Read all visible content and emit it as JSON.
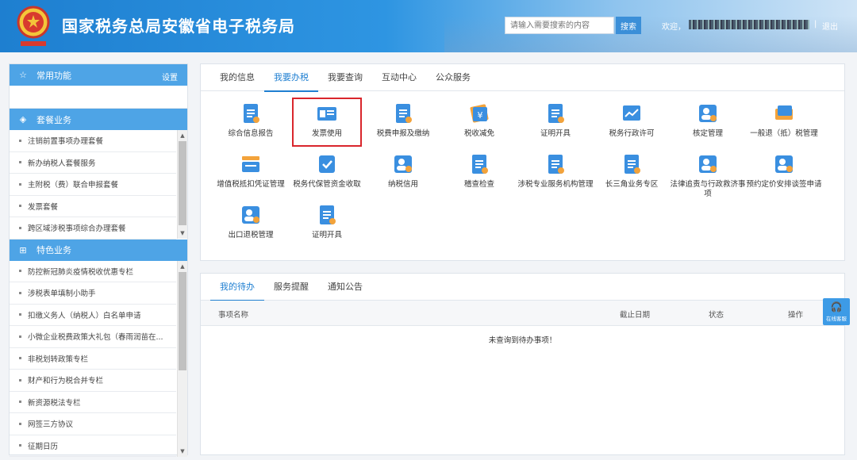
{
  "header": {
    "title": "国家税务总局安徽省电子税务局",
    "search_placeholder": "请输入需要搜索的内容",
    "search_button": "搜索",
    "welcome": "欢迎，",
    "separator": "|",
    "logout": "退出"
  },
  "sidebar": {
    "common": {
      "title": "常用功能",
      "settings": "设置"
    },
    "package": {
      "title": "套餐业务",
      "items": [
        "注销前置事项办理套餐",
        "新办纳税人套餐服务",
        "主附税（费）联合申报套餐",
        "发票套餐",
        "跨区域涉税事项综合办理套餐"
      ]
    },
    "special": {
      "title": "特色业务",
      "items": [
        "防控新冠肺炎疫情税收优惠专栏",
        "涉税表单填制小助手",
        "扣缴义务人（纳税人）白名单申请",
        "小微企业税费政策大礼包（春雨润苗在...",
        "非税划转政策专栏",
        "财产和行为税合并专栏",
        "新资源税法专栏",
        "网签三方协议",
        "征期日历"
      ]
    }
  },
  "main_tabs": [
    {
      "label": "我的信息"
    },
    {
      "label": "我要办税",
      "active": true
    },
    {
      "label": "我要查询"
    },
    {
      "label": "互动中心"
    },
    {
      "label": "公众服务"
    }
  ],
  "apps": [
    {
      "label": "综合信息报告",
      "icon": "report-icon"
    },
    {
      "label": "发票使用",
      "icon": "invoice-icon"
    },
    {
      "label": "税费申报及缴纳",
      "icon": "tax-declare-icon"
    },
    {
      "label": "税收减免",
      "icon": "tax-reduction-icon"
    },
    {
      "label": "证明开具",
      "icon": "certificate-icon"
    },
    {
      "label": "税务行政许可",
      "icon": "admin-license-icon"
    },
    {
      "label": "核定管理",
      "icon": "verification-icon"
    },
    {
      "label": "一般退（抵）税管理",
      "icon": "tax-refund-icon"
    },
    {
      "label": "增值税抵扣凭证管理",
      "icon": "vat-voucher-icon"
    },
    {
      "label": "税务代保管资金收取",
      "icon": "fund-custody-icon"
    },
    {
      "label": "纳税信用",
      "icon": "tax-credit-icon"
    },
    {
      "label": "稽查检查",
      "icon": "audit-icon"
    },
    {
      "label": "涉税专业服务机构管理",
      "icon": "agency-icon"
    },
    {
      "label": "长三角业务专区",
      "icon": "yangtze-icon"
    },
    {
      "label": "法律追责与行政救济事项",
      "icon": "legal-icon"
    },
    {
      "label": "预约定价安排谈签申请",
      "icon": "pricing-icon"
    },
    {
      "label": "出口退税管理",
      "icon": "export-refund-icon"
    },
    {
      "label": "证明开具",
      "icon": "certificate-icon"
    }
  ],
  "todo": {
    "tabs": [
      {
        "label": "我的待办",
        "active": true
      },
      {
        "label": "服务提醒"
      },
      {
        "label": "通知公告"
      }
    ],
    "columns": {
      "name": "事项名称",
      "deadline": "截止日期",
      "status": "状态",
      "action": "操作"
    },
    "empty": "未查询到待办事项！"
  },
  "float_service": {
    "label": "在线客服"
  },
  "colors": {
    "primary": "#1f7fd1",
    "sidebar_header": "#4ea4e6",
    "highlight": "#d9262c"
  }
}
